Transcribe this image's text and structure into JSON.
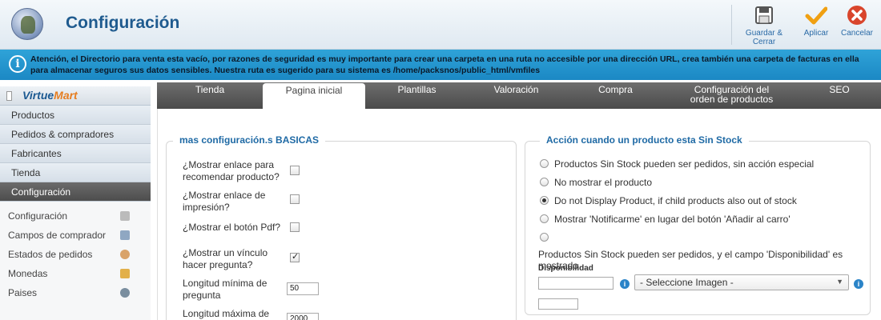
{
  "header": {
    "title": "Configuración",
    "toolbar": {
      "save_close": "Guardar & Cerrar",
      "apply": "Aplicar",
      "cancel": "Cancelar"
    }
  },
  "notice": {
    "text": "Atención, el Directorio para venta esta vacío, por razones de seguridad es muy importante para crear una carpeta en una ruta no accesible por una dirección URL, crea también una carpeta de facturas en ella para almacenar seguros sus datos sensibles. Nuestra ruta es sugerido para su sistema es /home/packsnos/public_html/vmfiles"
  },
  "sidebar": {
    "brand_a": "Virtue",
    "brand_b": "Mart",
    "items": [
      {
        "label": "Productos"
      },
      {
        "label": "Pedidos & compradores"
      },
      {
        "label": "Fabricantes"
      },
      {
        "label": "Tienda"
      },
      {
        "label": "Configuración"
      }
    ],
    "sub_items": [
      {
        "label": "Configuración",
        "icon": "tools-icon"
      },
      {
        "label": "Campos de comprador",
        "icon": "form-icon"
      },
      {
        "label": "Estados de pedidos",
        "icon": "status-icon"
      },
      {
        "label": "Monedas",
        "icon": "coins-icon"
      },
      {
        "label": "Paises",
        "icon": "globe-icon"
      }
    ]
  },
  "tabs": [
    {
      "label": "Tienda"
    },
    {
      "label": "Pagina inicial"
    },
    {
      "label": "Plantillas"
    },
    {
      "label": "Valoración"
    },
    {
      "label": "Compra"
    },
    {
      "label": "Configuración del orden de productos"
    },
    {
      "label": "SEO"
    }
  ],
  "basic": {
    "legend": "mas configuración.s BASICAS",
    "fields": [
      {
        "label": "¿Mostrar enlace para recomendar producto?",
        "checked": false
      },
      {
        "label": "¿Mostrar enlace de impresión?",
        "checked": false
      },
      {
        "label": "¿Mostrar el botón Pdf?",
        "checked": false
      },
      {
        "label": "¿Mostrar un vínculo hacer pregunta?",
        "checked": true
      },
      {
        "label": "Longitud mínima de pregunta",
        "value": "50"
      },
      {
        "label": "Longitud máxima de",
        "value": "2000"
      }
    ]
  },
  "stock": {
    "legend": "Acción cuando un producto esta Sin Stock",
    "options": [
      {
        "label": "Productos Sin Stock pueden ser pedidos, sin acción especial",
        "selected": false
      },
      {
        "label": "No mostrar el producto",
        "selected": false
      },
      {
        "label": "Do not Display Product, if child products also out of stock",
        "selected": true
      },
      {
        "label": "Mostrar 'Notificarme' en lugar del botón 'Añadir al carro'",
        "selected": false
      },
      {
        "label": "",
        "selected": false
      }
    ],
    "availability_desc": "Productos Sin Stock pueden ser pedidos, y el campo 'Disponibilidad' es mostrado",
    "availability_label": "Disponibilidad",
    "availability_value": "",
    "image_select": "- Seleccione Imagen -",
    "extra_value": ""
  }
}
